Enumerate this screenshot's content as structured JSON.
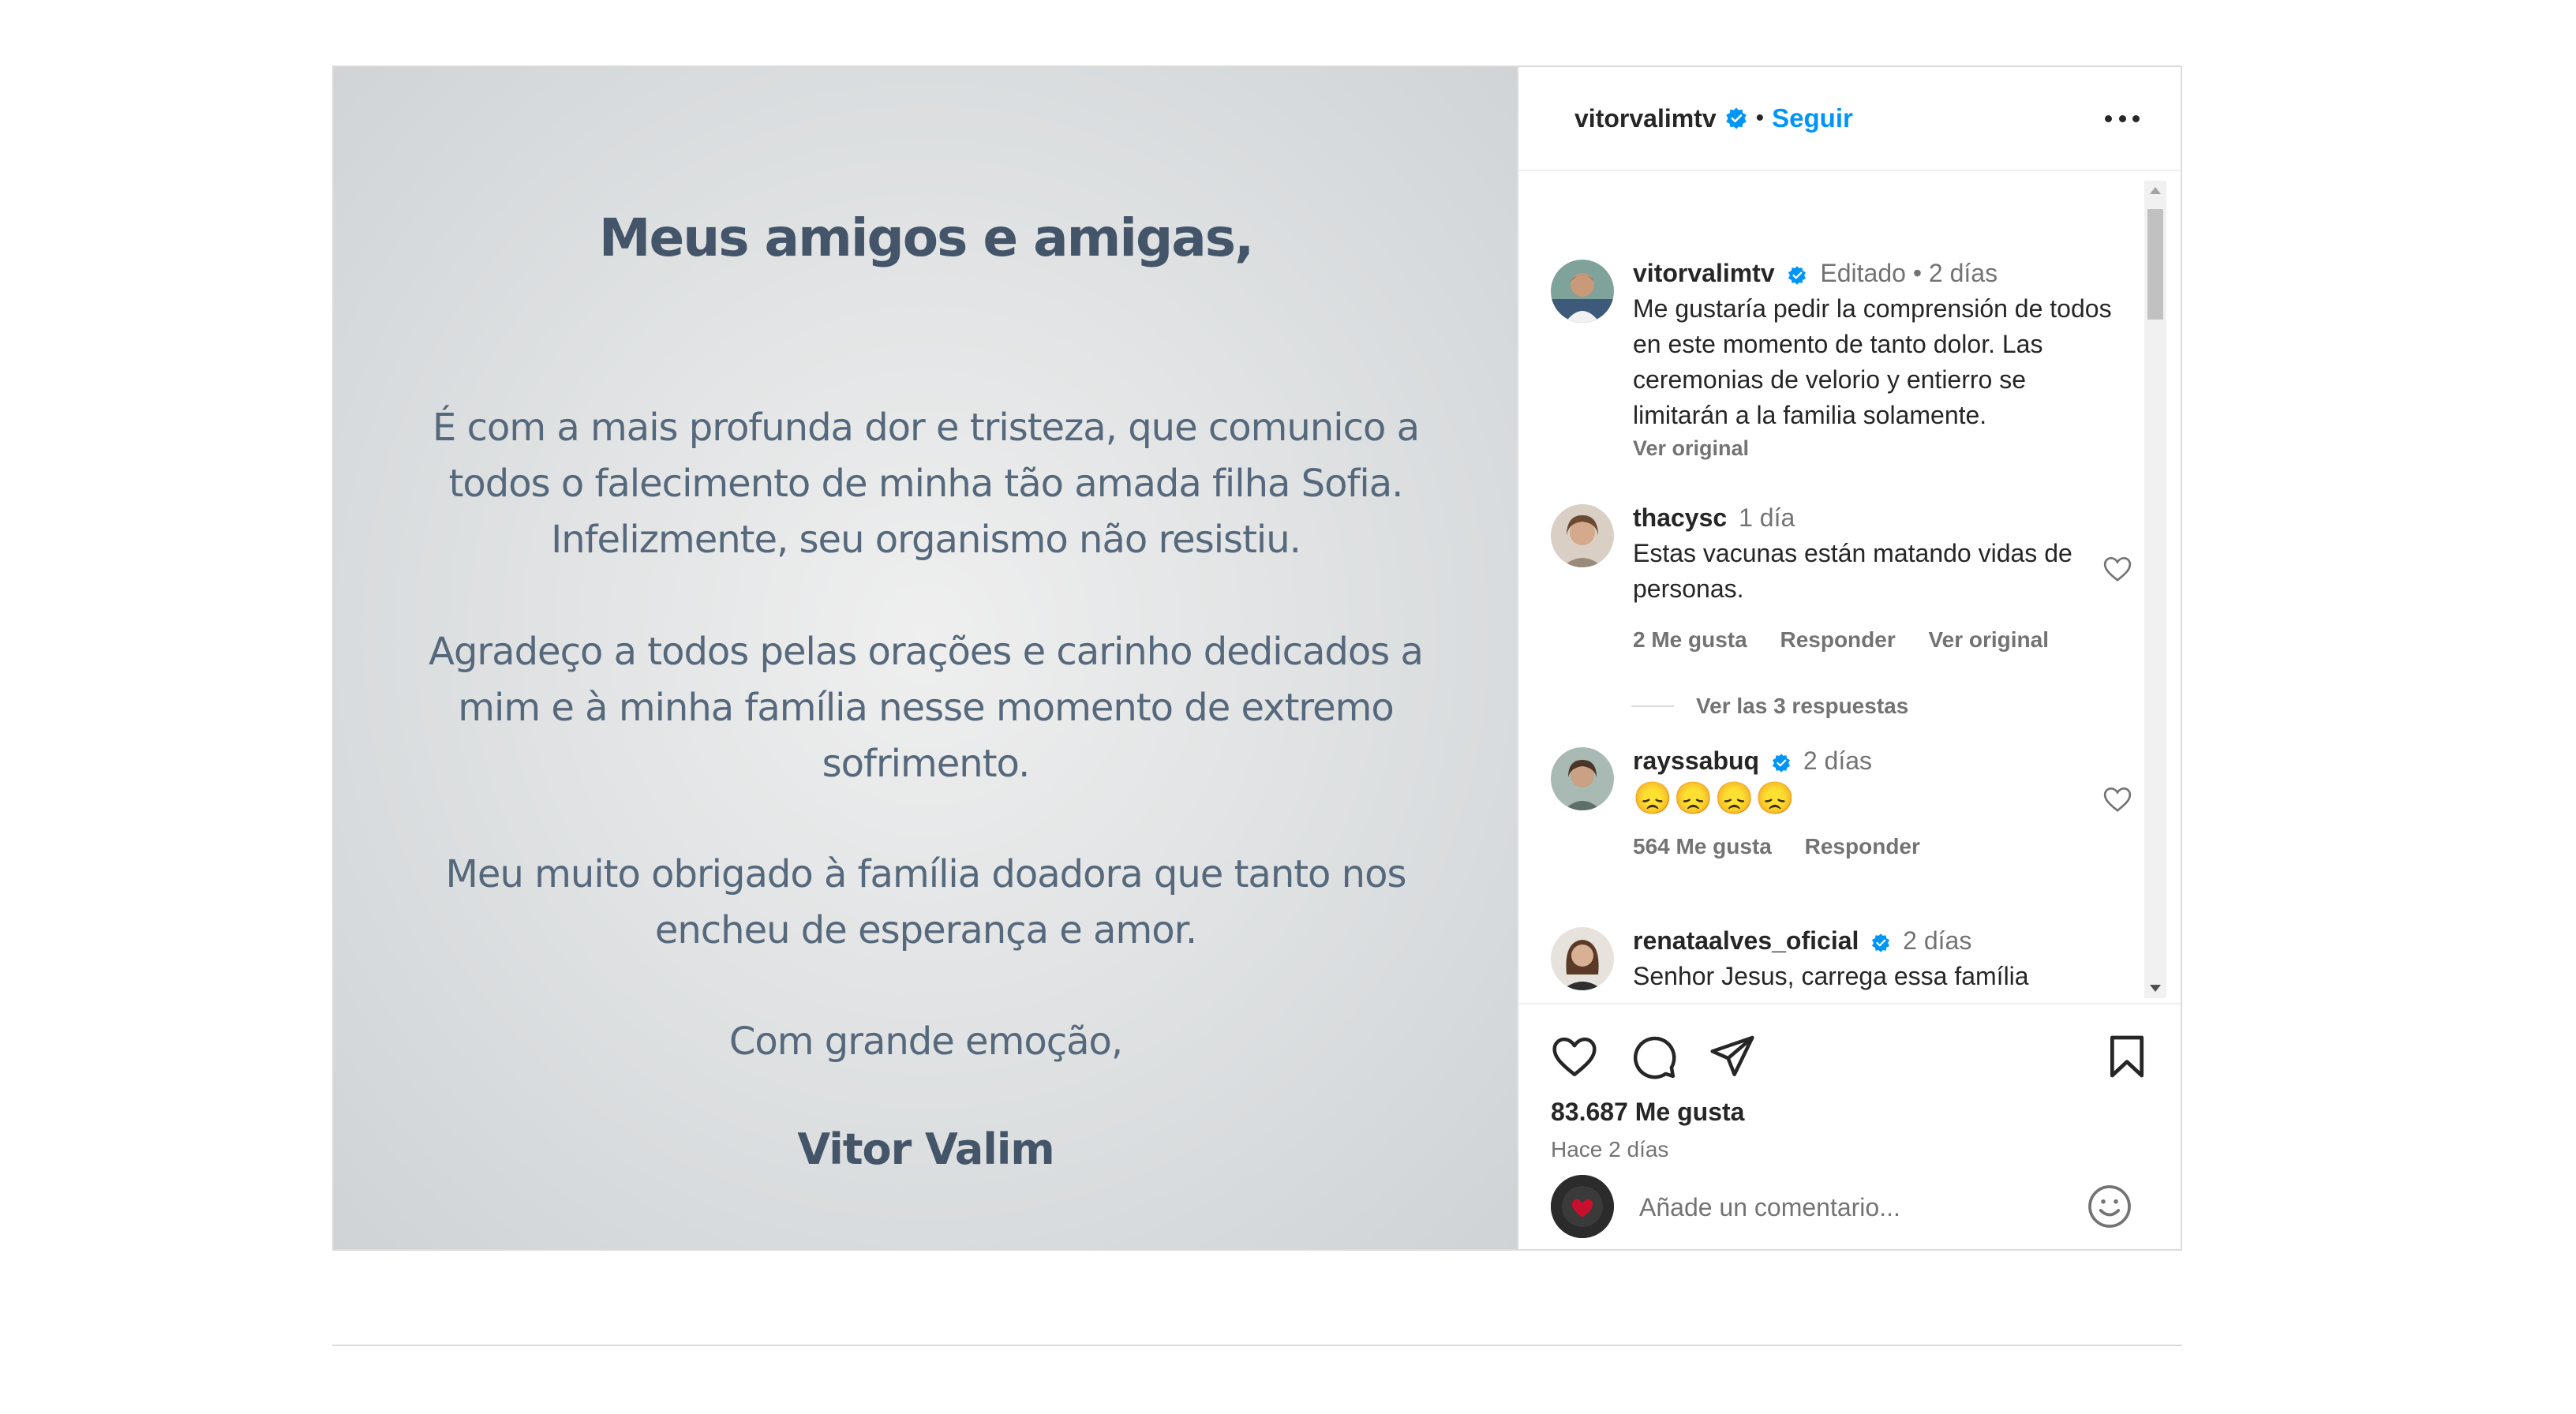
{
  "image_letter": {
    "title": "Meus amigos e amigas,",
    "paragraphs": [
      "É com a mais profunda dor e tristeza, que comunico a todos o falecimento de minha tão amada filha Sofia. Infelizmente, seu organismo não resistiu.",
      "Agradeço a todos pelas orações e carinho dedicados a mim e à minha família nesse momento de extremo sofrimento.",
      "Meu muito obrigado à família doadora que tanto nos encheu de esperança e amor.",
      "Com grande emoção,"
    ],
    "signature": "Vitor Valim"
  },
  "header": {
    "username": "vitorvalimtv",
    "separator": "•",
    "follow_label": "Seguir"
  },
  "comments": [
    {
      "username": "vitorvalimtv",
      "verified": true,
      "meta": "Editado •  2 días",
      "text": "Me gustaría pedir la comprensión de todos en este momento de tanto dolor. Las ceremonias de velorio y entierro se limitarán a la familia solamente.",
      "link": "Ver original"
    },
    {
      "username": "thacysc",
      "meta": "1 día",
      "text": "Estas vacunas están matando vidas de personas.",
      "likes": "2 Me gusta",
      "reply": "Responder",
      "translate": "Ver original",
      "replies": "Ver las 3 respuestas"
    },
    {
      "username": "rayssabuq",
      "verified": true,
      "meta": "2 días",
      "text": "😞😞😞😞",
      "likes": "564 Me gusta",
      "reply": "Responder"
    },
    {
      "username": "renataalves_oficial",
      "verified": true,
      "meta": "2 días",
      "text": "Senhor Jesus, carrega essa família"
    }
  ],
  "footer": {
    "likes": "83.687 Me gusta",
    "time": "Hace 2 días",
    "comment_placeholder": "Añade un comentario..."
  },
  "icons": {
    "verified_color": "#0095f6",
    "heart": "heart-icon",
    "comment": "comment-icon",
    "share": "share-icon",
    "bookmark": "bookmark-icon",
    "emoji": "emoji-icon",
    "more": "more-options-icon"
  }
}
